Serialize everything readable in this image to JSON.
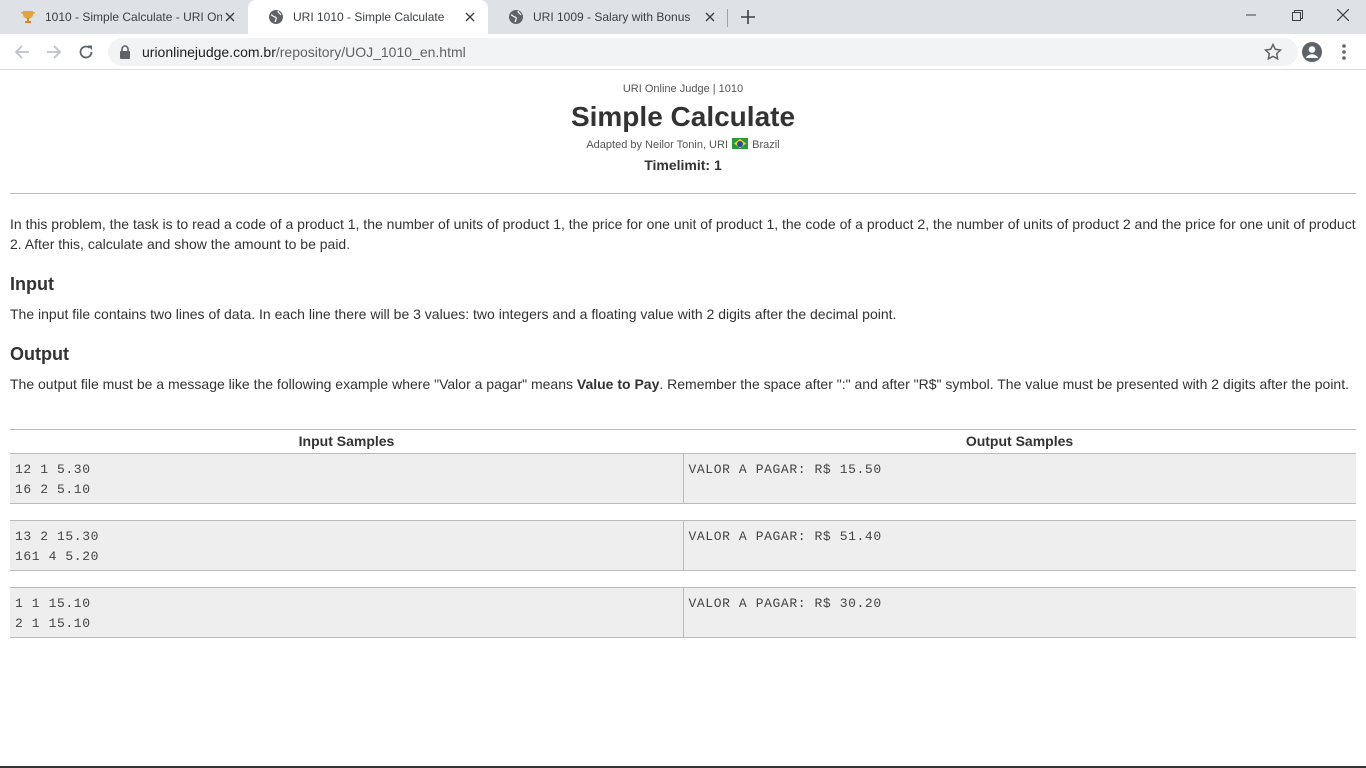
{
  "browser": {
    "tabs": [
      {
        "title": "1010 - Simple Calculate - URI Online Judge",
        "icon": "trophy-icon",
        "active": false
      },
      {
        "title": "URI 1010 - Simple Calculate",
        "icon": "globe-icon",
        "active": true
      },
      {
        "title": "URI 1009 - Salary with Bonus",
        "icon": "globe-icon",
        "active": false
      }
    ],
    "url_host": "urionlinejudge.com.br",
    "url_path": "/repository/UOJ_1010_en.html"
  },
  "page": {
    "breadcrumb": "URI Online Judge | 1010",
    "title": "Simple Calculate",
    "adapted_prefix": "Adapted by Neilor Tonin, URI",
    "adapted_country": "Brazil",
    "timelimit": "Timelimit: 1",
    "description": "In this problem, the task is to read a code of a product 1, the number of units of product 1, the price for one unit of product 1, the code of a product 2, the number of units of product 2 and the price for one unit of product 2. After this, calculate and show the amount to be paid.",
    "input_heading": "Input",
    "input_text": "The input file contains two lines of data. In each line there will be 3 values: two integers and a floating value with 2 digits after the decimal point.",
    "output_heading": "Output",
    "output_text_1": "The output file must be a message like the following example where \"Valor a pagar\" means ",
    "output_text_bold": "Value to Pay",
    "output_text_2": ". Remember the space after \":\" and after \"R$\" symbol. The value must be presented with 2 digits after the point.",
    "samples_input_header": "Input Samples",
    "samples_output_header": "Output Samples",
    "samples": [
      {
        "input": "12 1 5.30\n16 2 5.10",
        "output": "VALOR A PAGAR: R$ 15.50"
      },
      {
        "input": "13 2 15.30\n161 4 5.20",
        "output": "VALOR A PAGAR: R$ 51.40"
      },
      {
        "input": "1 1 15.10\n2 1 15.10",
        "output": "VALOR A PAGAR: R$ 30.20"
      }
    ]
  }
}
